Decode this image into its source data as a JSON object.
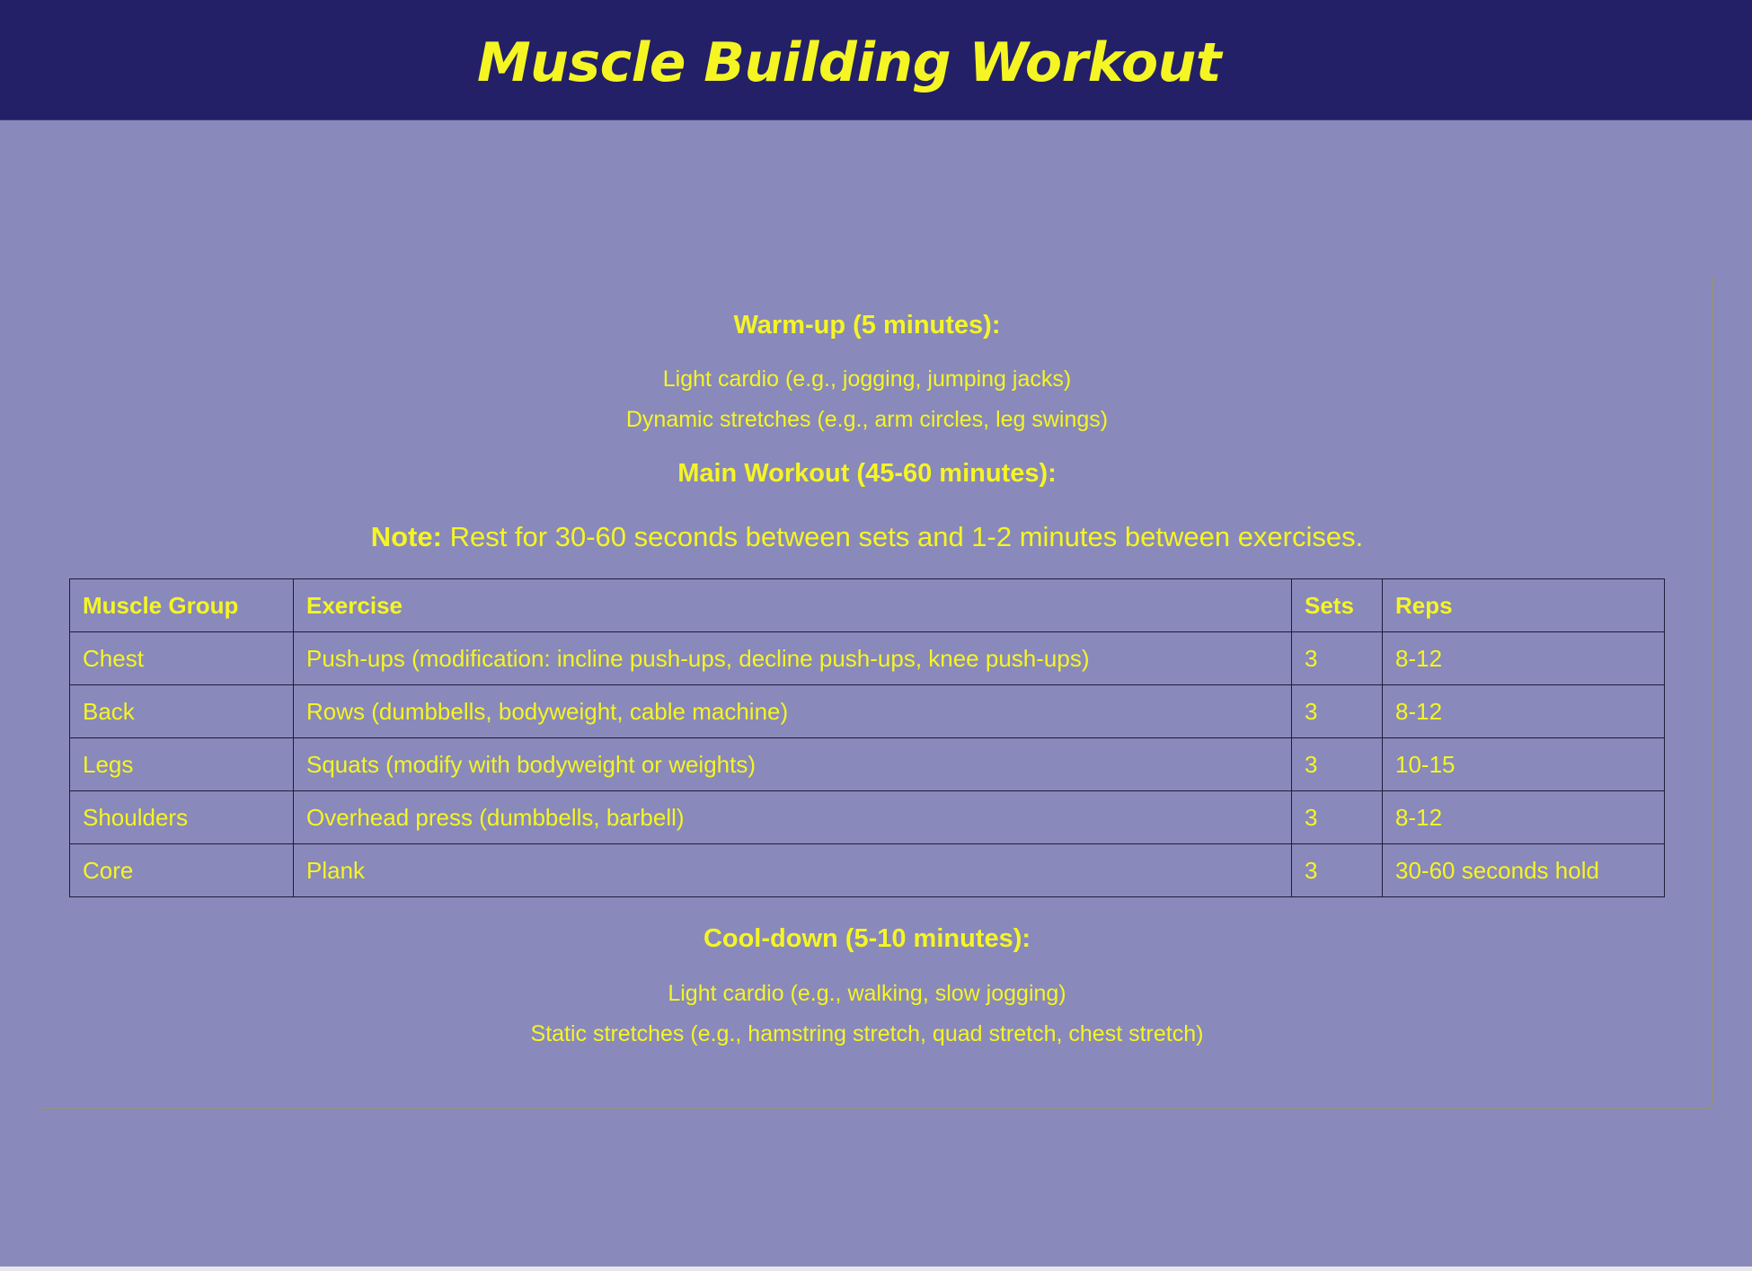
{
  "header": {
    "title": "Muscle Building Workout"
  },
  "warmup": {
    "heading": "Warm-up (5 minutes):",
    "items": [
      "Light cardio (e.g., jogging, jumping jacks)",
      "Dynamic stretches (e.g., arm circles, leg swings)"
    ]
  },
  "main_workout": {
    "heading": "Main Workout (45-60 minutes):",
    "note_label": "Note:",
    "note_text": " Rest for 30-60 seconds between sets and 1-2 minutes between exercises."
  },
  "table": {
    "headers": [
      "Muscle Group",
      "Exercise",
      "Sets",
      "Reps"
    ],
    "rows": [
      [
        "Chest",
        "Push-ups (modification: incline push-ups, decline push-ups, knee push-ups)",
        "3",
        "8-12"
      ],
      [
        "Back",
        "Rows (dumbbells, bodyweight, cable machine)",
        "3",
        "8-12"
      ],
      [
        "Legs",
        "Squats (modify with bodyweight or weights)",
        "3",
        "10-15"
      ],
      [
        "Shoulders",
        "Overhead press (dumbbells, barbell)",
        "3",
        "8-12"
      ],
      [
        "Core",
        "Plank",
        "3",
        "30-60 seconds hold"
      ]
    ]
  },
  "cooldown": {
    "heading": "Cool-down (5-10 minutes):",
    "items": [
      "Light cardio (e.g., walking, slow jogging)",
      "Static stretches (e.g., hamstring stretch, quad stretch, chest stretch)"
    ]
  },
  "colors": {
    "header_background": "#232067",
    "page_background": "#8989bb",
    "text": "#f5f524"
  }
}
